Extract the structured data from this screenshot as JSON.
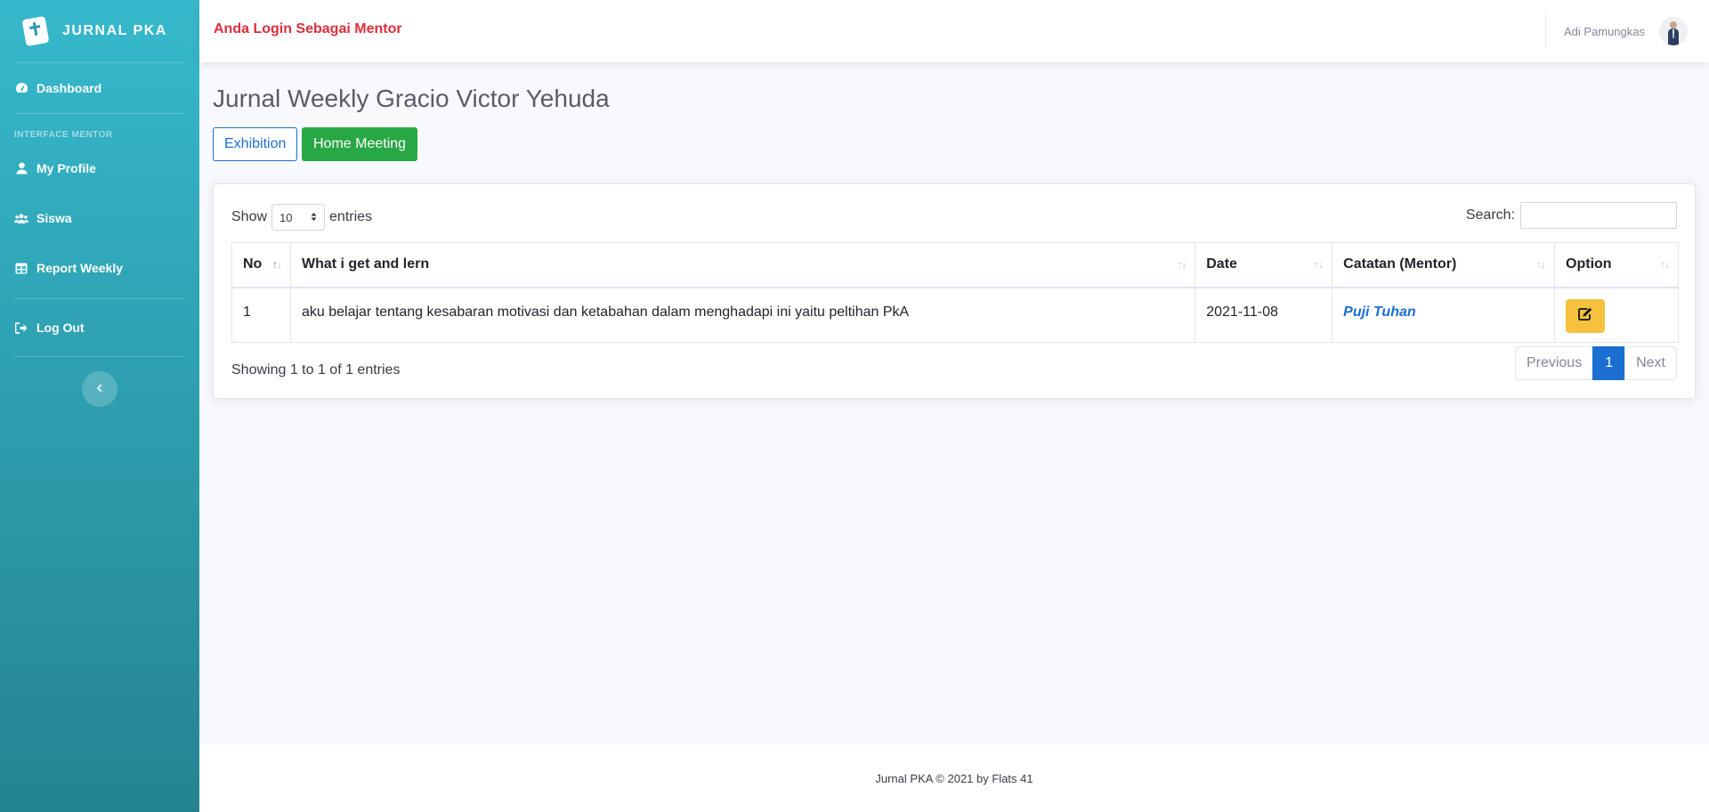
{
  "app": {
    "brand": "JURNAL PKA"
  },
  "sidebar": {
    "items": [
      {
        "label": "Dashboard",
        "icon": "tachometer-icon"
      },
      {
        "label": "My Profile",
        "icon": "user-icon"
      },
      {
        "label": "Siswa",
        "icon": "users-icon"
      },
      {
        "label": "Report Weekly",
        "icon": "table-icon"
      },
      {
        "label": "Log Out",
        "icon": "sign-out-icon"
      }
    ],
    "heading": "INTERFACE MENTOR"
  },
  "topbar": {
    "login_message": "Anda Login Sebagai Mentor",
    "user_name": "Adi Pamungkas"
  },
  "page": {
    "title": "Jurnal Weekly Gracio Victor Yehuda",
    "buttons": {
      "exhibition": "Exhibition",
      "home_meeting": "Home Meeting"
    }
  },
  "table_controls": {
    "show_label": "Show",
    "entries_value": "10",
    "entries_label": "entries",
    "search_label": "Search:",
    "search_value": ""
  },
  "table": {
    "headers": [
      "No",
      "What i get and lern",
      "Date",
      "Catatan (Mentor)",
      "Option"
    ],
    "rows": [
      {
        "no": "1",
        "what": "aku belajar tentang kesabaran motivasi dan ketabahan dalam menghadapi ini yaitu peltihan PkA",
        "date": "2021-11-08",
        "catatan": "Puji Tuhan",
        "option_icon": "edit-icon"
      }
    ]
  },
  "pagination": {
    "info": "Showing 1 to 1 of 1 entries",
    "previous": "Previous",
    "current": "1",
    "next": "Next"
  },
  "footer": {
    "text": "Jurnal PKA © 2021 by Flats 41"
  },
  "colors": {
    "sidebar_top": "#36b9cc",
    "sidebar_bottom": "#258391",
    "login_red": "#e02d3c",
    "primary_blue": "#1b6fd1",
    "success_green": "#28a745",
    "warning_yellow": "#f6c23e"
  }
}
